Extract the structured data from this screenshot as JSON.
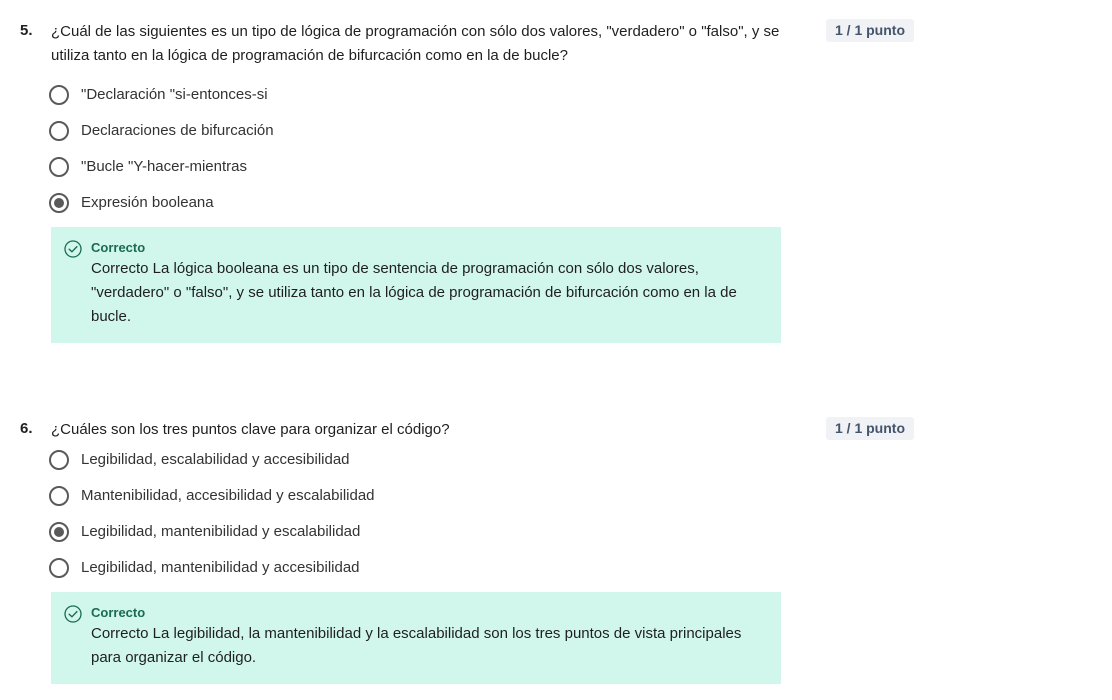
{
  "questions": [
    {
      "number": "5.",
      "text": "¿Cuál de las siguientes es un tipo de lógica de programación con sólo dos valores, \"verdadero\" o \"falso\", y se utiliza tanto en la lógica de programación de bifurcación como en la de bucle?",
      "points": "1 / 1 punto",
      "options": [
        {
          "label": "\"Declaración \"si-entonces-si",
          "selected": false
        },
        {
          "label": "Declaraciones de bifurcación",
          "selected": false
        },
        {
          "label": "\"Bucle \"Y-hacer-mientras",
          "selected": false
        },
        {
          "label": "Expresión booleana",
          "selected": true
        }
      ],
      "feedback": {
        "title": "Correcto",
        "text": "Correcto La lógica booleana es un tipo de sentencia de programación con sólo dos valores, \"verdadero\" o \"falso\", y se utiliza tanto en la lógica de programación de bifurcación como en la de bucle."
      }
    },
    {
      "number": "6.",
      "text": "¿Cuáles son los tres puntos clave para organizar el código?",
      "points": "1 / 1 punto",
      "options": [
        {
          "label": "Legibilidad, escalabilidad y accesibilidad",
          "selected": false
        },
        {
          "label": "Mantenibilidad, accesibilidad y escalabilidad",
          "selected": false
        },
        {
          "label": "Legibilidad, mantenibilidad y escalabilidad",
          "selected": true
        },
        {
          "label": "Legibilidad, mantenibilidad y accesibilidad",
          "selected": false
        }
      ],
      "feedback": {
        "title": "Correcto",
        "text": "Correcto La legibilidad, la mantenibilidad y la escalabilidad son los tres puntos de vista principales para organizar el código."
      }
    }
  ],
  "colors": {
    "feedback_bg": "#d1f7ec",
    "feedback_title": "#1b6b4f",
    "points_bg": "#f0f2f5",
    "radio": "#5a5a5a"
  },
  "icons": {
    "feedback": "check-circle-icon",
    "option": "radio-icon"
  }
}
